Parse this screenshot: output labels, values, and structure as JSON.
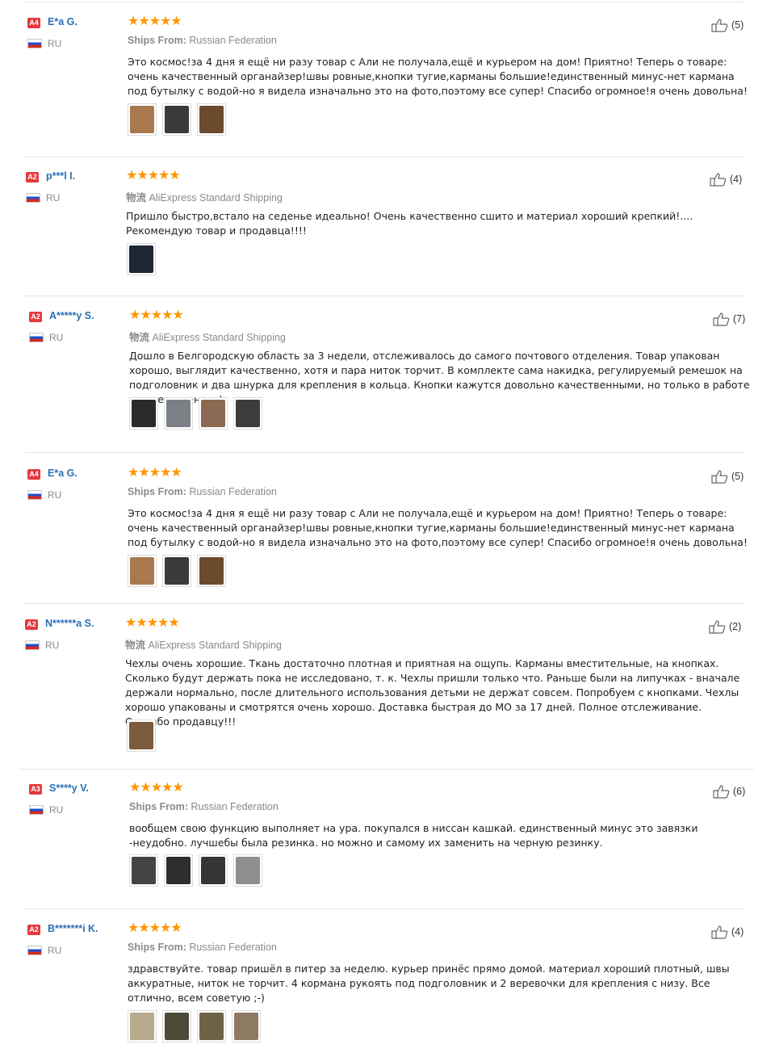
{
  "reviews": [
    {
      "badge": "A4",
      "name": "E*a G.",
      "country": "RU",
      "stars": "★★★★★",
      "ship_key": "Ships From:",
      "ship_val": "Russian Federation",
      "text": "Это космос!за 4 дня я ещё ни разу товар с Али не получала,ещё и курьером на дом! Приятно! Теперь о товаре: очень качественный органайзер!швы ровные,кнопки тугие,карманы большие!единственный минус-нет кармана под бутылку с водой-но я видела изначально это на фото,поэтому все супер! Спасибо огромное!я очень довольна!",
      "likes": "(5)",
      "thumbs": [
        "#a9784e",
        "#3a3a3a",
        "#6b4a2e"
      ]
    },
    {
      "badge": "A2",
      "name": "p***l I.",
      "country": "RU",
      "stars": "★★★★★",
      "ship_key": "物流",
      "ship_val": "AliExpress Standard Shipping",
      "text": "Пришло быстро,встало на седенье идеально! Очень качественно сшито и материал хороший крепкий!.... Рекомендую товар и продавца!!!!",
      "likes": "(4)",
      "thumbs": [
        "#1e2733"
      ]
    },
    {
      "badge": "A2",
      "name": "A*****y S.",
      "country": "RU",
      "stars": "★★★★★",
      "ship_key": "物流",
      "ship_val": "AliExpress Standard Shipping",
      "text": "Дошло в Белгородскую область за 3 недели, отслеживалось до самого почтового отделения. Товар упакован хорошо, выглядит качественно, хотя и пара ниток торчит. В комплекте сама накидка, регулируемый ремешок на подголовник и два шнурка для крепления в кольца. Кнопки кажутся довольно качественными, но только в работе сможем оценить)",
      "likes": "(7)",
      "thumbs": [
        "#2b2b2b",
        "#7b7f86",
        "#8a6a52",
        "#3c3c3c"
      ]
    },
    {
      "badge": "A4",
      "name": "E*a G.",
      "country": "RU",
      "stars": "★★★★★",
      "ship_key": "Ships From:",
      "ship_val": "Russian Federation",
      "text": "Это космос!за 4 дня я ещё ни разу товар с Али не получала,ещё и курьером на дом! Приятно! Теперь о товаре: очень качественный органайзер!швы ровные,кнопки тугие,карманы большие!единственный минус-нет кармана под бутылку с водой-но я видела изначально это на фото,поэтому все супер! Спасибо огромное!я очень довольна!",
      "likes": "(5)",
      "thumbs": [
        "#a9784e",
        "#3a3a3a",
        "#6b4a2e"
      ]
    },
    {
      "badge": "A2",
      "name": "N******a S.",
      "country": "RU",
      "stars": "★★★★★",
      "ship_key": "物流",
      "ship_val": "AliExpress Standard Shipping",
      "text": "Чехлы очень хорошие. Ткань достаточно плотная и приятная на ощупь. Карманы вместительные, на кнопках. Сколько будут держать пока не исследовано, т. к. Чехлы пришли только что. Раньше были на липучках - вначале держали нормально, после длительного использования детьми не держат совсем. Попробуем с кнопками. Чехлы хорошо упакованы и смотрятся очень хорошо. Доставка быстрая до МО за 17 дней. Полное отслеживание. Спасибо продавцу!!!",
      "likes": "(2)",
      "thumbs": [
        "#7a5c3c"
      ]
    },
    {
      "badge": "A3",
      "name": "S****y V.",
      "country": "RU",
      "stars": "★★★★★",
      "ship_key": "Ships From:",
      "ship_val": "Russian Federation",
      "text": "вообщем свою функцию выполняет на ура. покупался в ниссан кашкай. единственный минус это завязки -неудобно. лучшебы была резинка. но можно и самому их заменить на черную резинку.",
      "likes": "(6)",
      "thumbs": [
        "#444444",
        "#2e2e2e",
        "#353535",
        "#8f8f8f"
      ]
    },
    {
      "badge": "A2",
      "name": "B*******i K.",
      "country": "RU",
      "stars": "★★★★★",
      "ship_key": "Ships From:",
      "ship_val": "Russian Federation",
      "text": "здравствуйте. товар пришёл в питер за неделю. курьер принёс прямо домой. материал хороший плотный, швы аккуратные, ниток не торчит. 4 кормана рукоять под подголовник и 2 веревочки для крепления с низу. Все отлично, всем советую ;-)",
      "likes": "(4)",
      "thumbs": [
        "#b9a98d",
        "#4d4a38",
        "#6e6246",
        "#8d7a62"
      ]
    }
  ]
}
